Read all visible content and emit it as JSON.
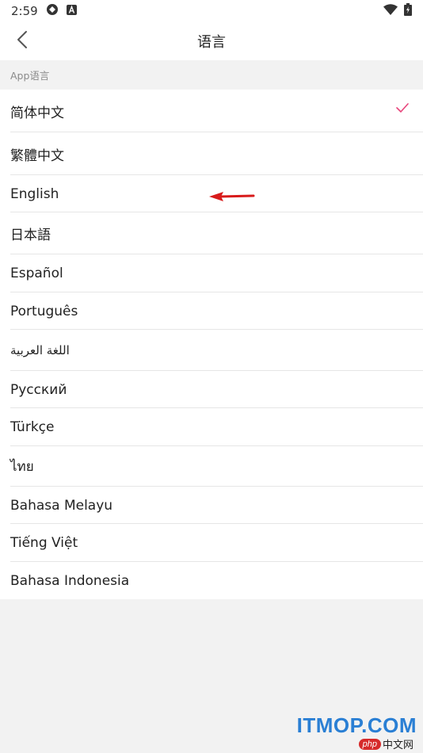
{
  "status_bar": {
    "time": "2:59",
    "icons": [
      "sync-icon",
      "notification-a-icon",
      "wifi-icon",
      "battery-charging-icon"
    ]
  },
  "app_bar": {
    "title": "语言",
    "back_icon": "chevron-left-icon"
  },
  "section": {
    "header": "App语言"
  },
  "languages": [
    {
      "label": "简体中文",
      "selected": true
    },
    {
      "label": "繁體中文",
      "selected": false
    },
    {
      "label": "English",
      "selected": false
    },
    {
      "label": "日本語",
      "selected": false
    },
    {
      "label": "Español",
      "selected": false
    },
    {
      "label": "Português",
      "selected": false
    },
    {
      "label": "اللغة العربية",
      "selected": false
    },
    {
      "label": "Русский",
      "selected": false
    },
    {
      "label": "Türkçe",
      "selected": false
    },
    {
      "label": "ไทย",
      "selected": false
    },
    {
      "label": "Bahasa Melayu",
      "selected": false
    },
    {
      "label": "Tiếng Việt",
      "selected": false
    },
    {
      "label": "Bahasa Indonesia",
      "selected": false
    }
  ],
  "colors": {
    "check": "#e8467c",
    "annotation_arrow": "#d81b1b",
    "watermark_brand": "#2a7fd4"
  },
  "watermark": {
    "brand": "ITMOP.COM",
    "php": "php",
    "cn": "中文网"
  }
}
